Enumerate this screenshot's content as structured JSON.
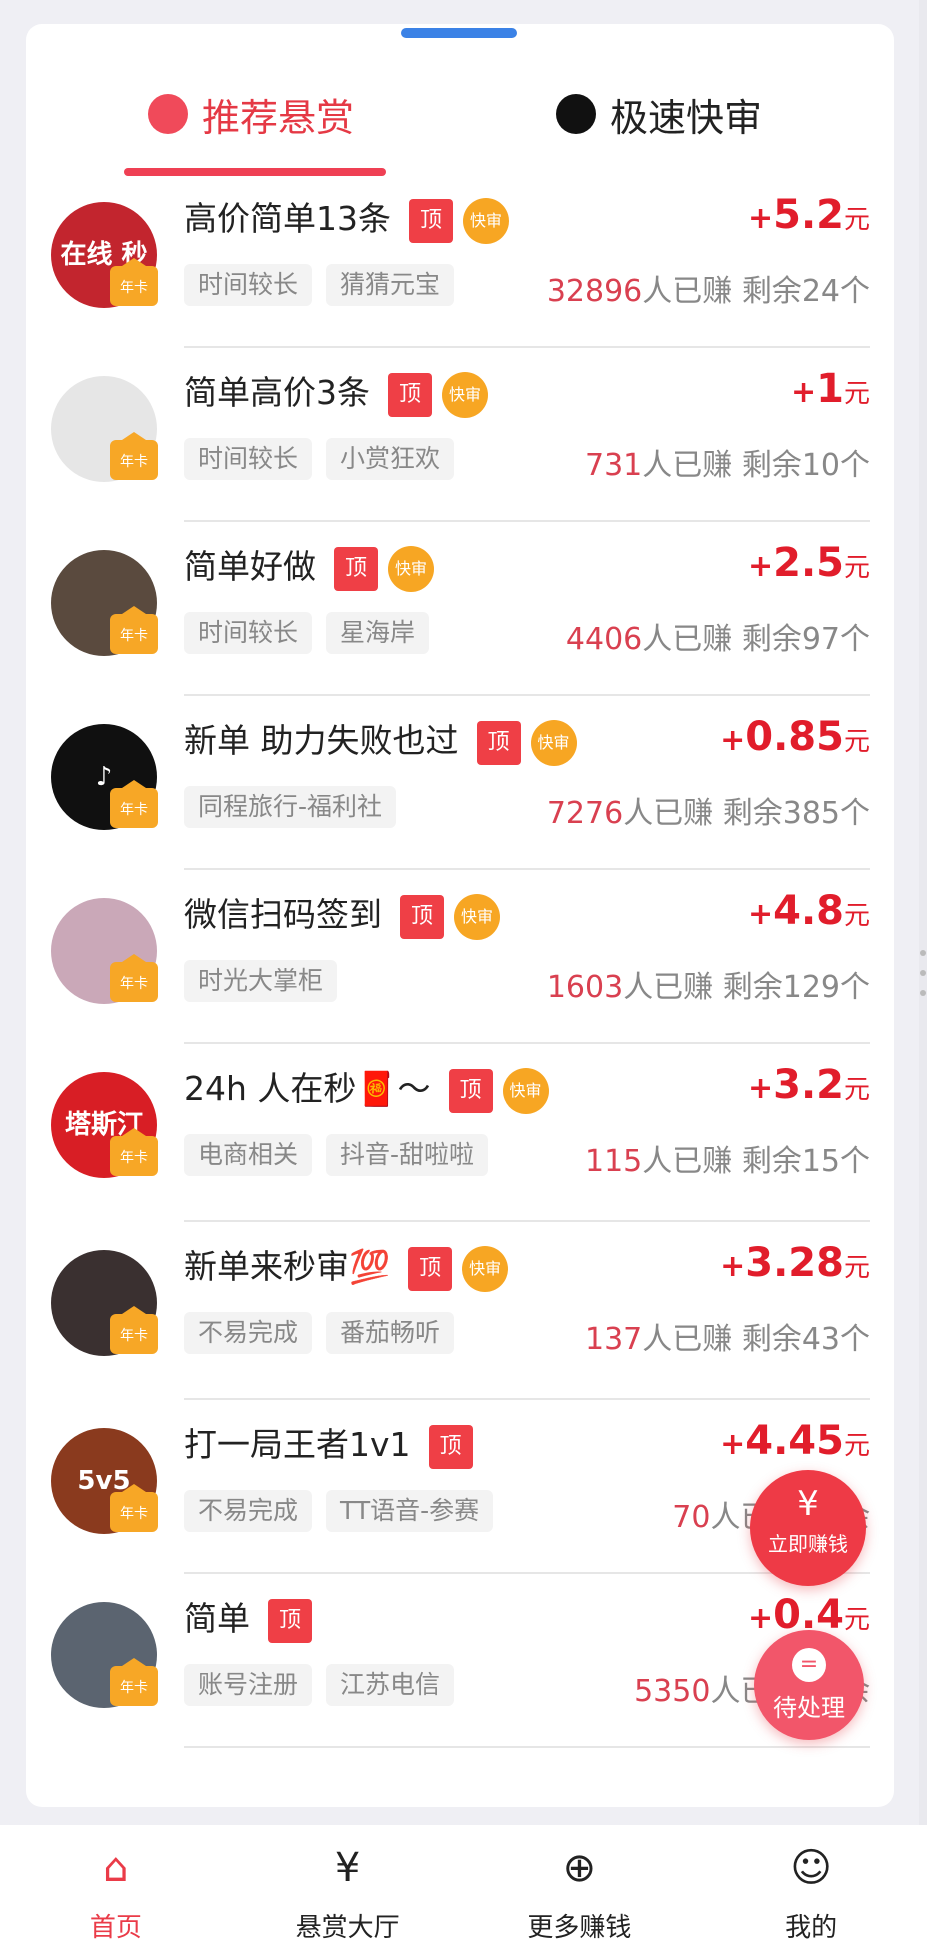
{
  "tabs": [
    {
      "label": "推荐悬赏",
      "icon": "flame-icon",
      "active": true
    },
    {
      "label": "极速快审",
      "icon": "user-circle-icon",
      "active": false
    }
  ],
  "badges": {
    "top": "顶",
    "fast": "快审",
    "annual": "年卡"
  },
  "reward_prefix": "+",
  "reward_unit": "元",
  "earned_suffix": "人已赚",
  "remaining_prefix": "剩余",
  "remaining_suffix": "个",
  "tasks": [
    {
      "title": "高价简单13条",
      "fast": true,
      "reward": "5.2",
      "tags": [
        "时间较长",
        "猜猜元宝"
      ],
      "earned": "32896",
      "remaining": "24",
      "avatar_color": "#c2252e",
      "avatar_text": "在线 秒"
    },
    {
      "title": "简单高价3条",
      "fast": true,
      "reward": "1",
      "tags": [
        "时间较长",
        "小赏狂欢"
      ],
      "earned": "731",
      "remaining": "10",
      "avatar_color": "#e6e6e6",
      "avatar_text": ""
    },
    {
      "title": "简单好做",
      "fast": true,
      "reward": "2.5",
      "tags": [
        "时间较长",
        "星海岸"
      ],
      "earned": "4406",
      "remaining": "97",
      "avatar_color": "#5a4a3e",
      "avatar_text": ""
    },
    {
      "title": "新单 助力失败也过",
      "fast": true,
      "reward": "0.85",
      "tags": [
        "同程旅行-福利社"
      ],
      "earned": "7276",
      "remaining": "385",
      "avatar_color": "#101010",
      "avatar_text": "♪"
    },
    {
      "title": "微信扫码签到",
      "fast": true,
      "reward": "4.8",
      "tags": [
        "时光大掌柜"
      ],
      "earned": "1603",
      "remaining": "129",
      "avatar_color": "#caa8b8",
      "avatar_text": ""
    },
    {
      "title": "24h 人在秒🧧～",
      "fast": true,
      "reward": "3.2",
      "tags": [
        "电商相关",
        "抖音-甜啦啦"
      ],
      "earned": "115",
      "remaining": "15",
      "avatar_color": "#d81e25",
      "avatar_text": "塔斯汀"
    },
    {
      "title": "新单来秒审💯",
      "fast": true,
      "reward": "3.28",
      "tags": [
        "不易完成",
        "番茄畅听"
      ],
      "earned": "137",
      "remaining": "43",
      "avatar_color": "#3a3030",
      "avatar_text": ""
    },
    {
      "title": "打一局王者1v1",
      "fast": false,
      "reward": "4.45",
      "tags": [
        "不易完成",
        "TT语音-参赛"
      ],
      "earned": "70",
      "remaining": "",
      "avatar_color": "#8a3a1e",
      "avatar_text": "5v5"
    },
    {
      "title": "简单",
      "fast": false,
      "reward": "0.4",
      "tags": [
        "账号注册",
        "江苏电信"
      ],
      "earned": "5350",
      "remaining": "",
      "avatar_color": "#5b6470",
      "avatar_text": ""
    }
  ],
  "fab": {
    "earn": {
      "icon": "¥",
      "label": "立即赚钱"
    },
    "pending": {
      "icon": "=",
      "label": "待处理"
    }
  },
  "nav": [
    {
      "label": "首页",
      "icon": "home-icon",
      "glyph": "⌂",
      "active": true
    },
    {
      "label": "悬赏大厅",
      "icon": "reward-hall-icon",
      "glyph": "¥",
      "active": false
    },
    {
      "label": "更多赚钱",
      "icon": "gamepad-icon",
      "glyph": "⊕",
      "active": false
    },
    {
      "label": "我的",
      "icon": "profile-icon",
      "glyph": "☺",
      "active": false
    }
  ]
}
